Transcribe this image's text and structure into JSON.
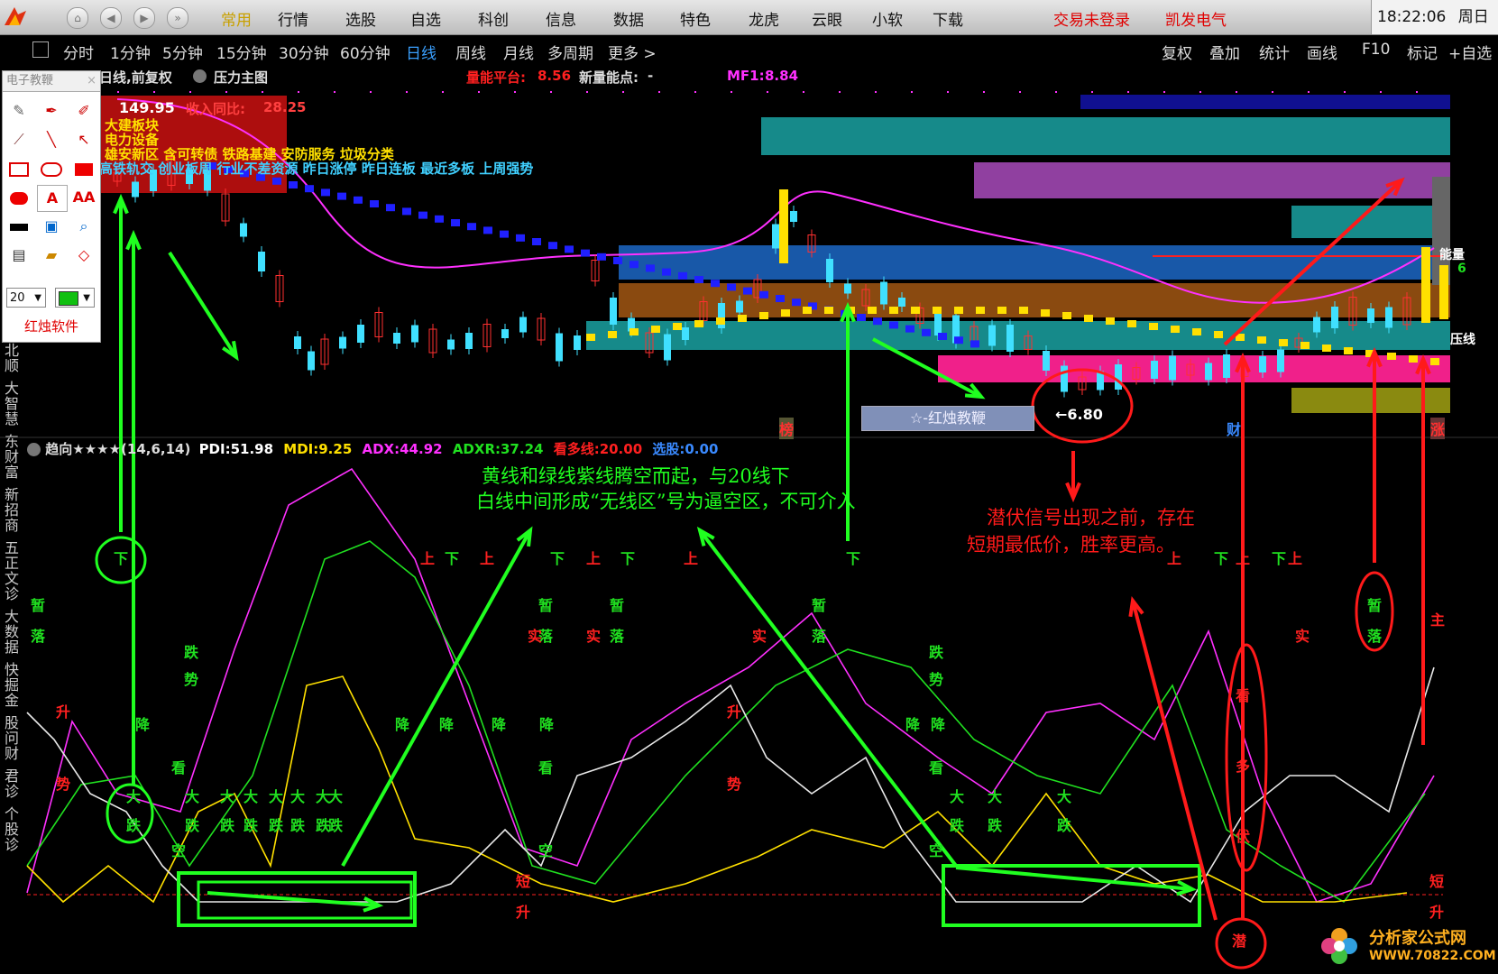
{
  "topbar": {
    "menu": [
      "常用",
      "行情",
      "选股",
      "自选",
      "科创",
      "信息",
      "数据",
      "特色",
      "龙虎",
      "云眼",
      "小软",
      "下载"
    ],
    "highlight_index": 0,
    "trade_status": "交易未登录",
    "stock_name": "凯发电气",
    "time": "18:22:06",
    "weekday": "周日"
  },
  "periodbar": {
    "periods": [
      "分时",
      "1分钟",
      "5分钟",
      "15分钟",
      "30分钟",
      "60分钟",
      "日线",
      "周线",
      "月线",
      "多周期",
      "更多 >"
    ],
    "active_index": 6,
    "tools": [
      "复权",
      "叠加",
      "统计",
      "画线",
      "F10",
      "标记",
      "+自选"
    ]
  },
  "drawtools": {
    "title": "电子教鞭",
    "close": "×",
    "size_value": "20",
    "brand": "红烛软件",
    "text_tool": "A",
    "font_tool": "AA"
  },
  "left_tabs": [
    "北顺",
    "大智慧",
    "东财富",
    "新招商",
    "五正文诊",
    "大数据",
    "快掘金",
    "股问财",
    "君诊",
    "个股诊"
  ],
  "main_chart": {
    "title": "日线,前复权",
    "overlay": "压力主图",
    "ind1_label": "量能平台:",
    "ind1_value": "8.56",
    "ind2_label": "新量能点:",
    "ind2_value": "-",
    "mf1_label": "MF1:",
    "mf1_value": "8.84",
    "high_price": "149.95",
    "revenue_label": "收入同比:",
    "revenue_value": "28.25",
    "concepts1": "大建板块",
    "concepts2": "电力设备",
    "concepts3": "雄安新区 含可转债 铁路基建 安防服务 垃圾分类",
    "concepts4": "高铁轨交 创业板周 行业不差资源 昨日涨停 昨日连板 最近多板 上周强势",
    "low_price": "←6.80",
    "tag": "☆-红烛教鞭",
    "bang": "榜",
    "cai": "财",
    "zhang": "涨",
    "right_label1": "能量",
    "right_label2": "6",
    "right_label3": "压线"
  },
  "indicator": {
    "name": "趋向★★★★(14,6,14)",
    "pdi_label": "PDI:",
    "pdi": "51.98",
    "mdi_label": "MDI:",
    "mdi": "9.25",
    "adx_label": "ADX:",
    "adx": "44.92",
    "adxr_label": "ADXR:",
    "adxr": "37.24",
    "duo_label": "看多线:",
    "duo": "20.00",
    "xuan_label": "选股:",
    "xuan": "0.00"
  },
  "annotations": {
    "green_note_line1": "黄线和绿线紫线腾空而起，与20线下",
    "green_note_line2": "白线中间形成“无线区”号为逼空区，不可介入",
    "red_note_line1": "潜伏信号出现之前，存在",
    "red_note_line2": "短期最低价，胜率更高。"
  },
  "signals": {
    "xia": "下",
    "shang": "上",
    "zan": "暂",
    "luo": "落",
    "die": "跌",
    "shi": "势",
    "jiang": "降",
    "sheng": "升",
    "kan": "看",
    "da": "大",
    "kong": "空",
    "duan": "短",
    "shi2": "实",
    "qian": "潜",
    "duo": "多",
    "zhu": "主",
    "fu": "伏"
  },
  "watermark": {
    "title": "分析家公式网",
    "url": "WWW.70822.COM"
  },
  "colors": {
    "up": "#ff3030",
    "down": "#40e0ff",
    "green_anno": "#20ff20",
    "red_anno": "#ff1a1a",
    "magenta": "#ff30ff",
    "yellow": "#ffe000"
  }
}
